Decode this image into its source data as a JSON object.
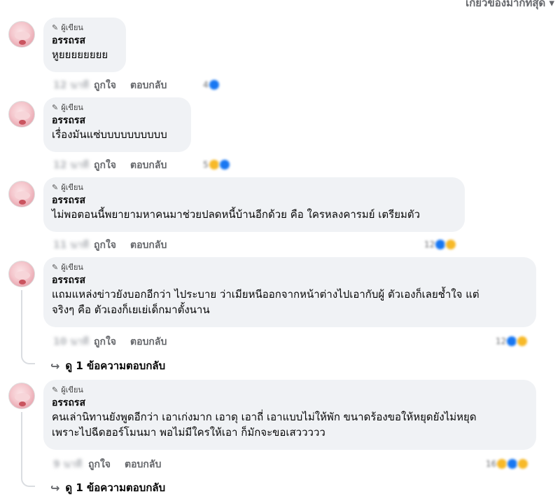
{
  "sort_label": "เกี่ยวข้องมากที่สุด ▾",
  "author_badge": "ผู้เขียน",
  "actions": {
    "like": "ถูกใจ",
    "reply": "ตอบกลับ"
  },
  "comments": [
    {
      "author": "อรรถรส",
      "time": "12 นาที",
      "lines": [
        "หูยยยยยยยย"
      ],
      "reaction_count": "4"
    },
    {
      "author": "อรรถรส",
      "time": "12 นาที",
      "lines": [
        "เรื่องมันแซ่บบบบบบบบบบ"
      ],
      "reaction_count": "5"
    },
    {
      "author": "อรรถรส",
      "time": "11 นาที",
      "lines": [
        "ไม่พอตอนนี้พยายามหาคนมาช่วยปลดหนี้บ้านอีกด้วย คือ ใครหลงคารมย์ เตรียมตัว"
      ],
      "reaction_count": "12"
    },
    {
      "author": "อรรถรส",
      "time": "10 นาที",
      "lines": [
        "แถมแหล่งข่าวยังบอกอีกว่า ไประบาย ว่าเมียหนีออกจากหน้าต่างไปเอากับผู้ ตัวเองก็เลยช้ำใจ แต่",
        "จริงๆ คือ ตัวเองก็เยเย่เด็กมาตั้งนาน"
      ],
      "reaction_count": "12",
      "replies_label": "ดู 1 ข้อความตอบกลับ"
    },
    {
      "author": "อรรถรส",
      "time": "9 นาที",
      "lines": [
        "คนเล่านิทานยังพูดอีกว่า เอาเก่งมาก เอาดุ เอาถี่ เอาแบบไม่ให้พัก ขนาดร้องขอให้หยุดยังไม่หยุด",
        "เพราะไปฉีดฮอร์โมนมา พอไม่มีใครให้เอา ก็มักจะขอเสววววว"
      ],
      "reaction_count": "16",
      "replies_label": "ดู 1 ข้อความตอบกลับ"
    }
  ]
}
